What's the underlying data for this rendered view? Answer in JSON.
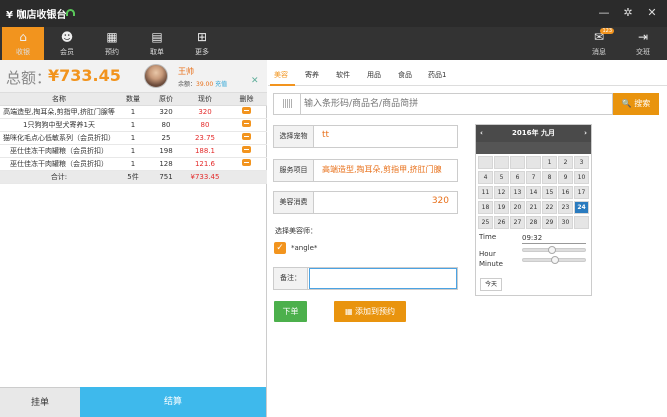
{
  "window": {
    "title": "¥ 咖店收银台"
  },
  "toolbar": {
    "items": [
      {
        "label": "收银",
        "icon": "home-icon"
      },
      {
        "label": "会员",
        "icon": "users-icon"
      },
      {
        "label": "预约",
        "icon": "calendar-icon"
      },
      {
        "label": "取单",
        "icon": "printer-icon"
      },
      {
        "label": "更多",
        "icon": "grid-icon"
      }
    ],
    "right": [
      {
        "label": "消息",
        "icon": "chat-icon",
        "badge": "123"
      },
      {
        "label": "交班",
        "icon": "exit-icon"
      }
    ]
  },
  "cart": {
    "total_label": "总额：",
    "total_value": "¥733.45",
    "member": {
      "name": "王帅",
      "balance_label": "余额：",
      "balance": "39.00",
      "recharge": "充值"
    },
    "columns": [
      "名称",
      "数量",
      "原价",
      "现价",
      "删除"
    ],
    "rows": [
      {
        "name": "高端造型,掏耳朵,剪指甲,挤肛门腺等",
        "qty": "1",
        "orig": "320",
        "price": "320"
      },
      {
        "name": "1只狗狗中型犬寄养1天",
        "qty": "1",
        "orig": "80",
        "price": "80"
      },
      {
        "name": "猫咪化毛点心低敏系列（会员折扣）",
        "qty": "1",
        "orig": "25",
        "price": "23.75"
      },
      {
        "name": "巫仕佳冻干肉罐粮（会员折扣）",
        "qty": "1",
        "orig": "198",
        "price": "188.1"
      },
      {
        "name": "巫仕佳冻干肉罐粮（会员折扣）",
        "qty": "1",
        "orig": "128",
        "price": "121.6"
      }
    ],
    "summary": {
      "label": "合计:",
      "qty": "5件",
      "orig": "751",
      "price": "¥733.45"
    }
  },
  "tabs": [
    "美容",
    "寄养",
    "软件",
    "用品",
    "食品",
    "药品1"
  ],
  "search": {
    "placeholder": "输入条形码/商品名/商品简拼",
    "button": "搜索"
  },
  "form": {
    "pet_label": "选择宠物",
    "pet_value": "tt",
    "service_label": "服务项目",
    "service_value": "高端造型,掏耳朵,剪指甲,挤肛门腺",
    "fee_label": "美容消费",
    "fee_value": "320",
    "beautician_label": "选择美容师：",
    "beautician_name": "*angle*",
    "note_label": "备注：",
    "submit": "下单",
    "reserve": "添加到预约"
  },
  "calendar": {
    "title": "2016年 九月",
    "prev": "‹",
    "next": "›",
    "weeks": [
      [
        "",
        "",
        "",
        "",
        "1",
        "2",
        "3"
      ],
      [
        "4",
        "5",
        "6",
        "7",
        "8",
        "9",
        "10"
      ],
      [
        "11",
        "12",
        "13",
        "14",
        "15",
        "16",
        "17"
      ],
      [
        "18",
        "19",
        "20",
        "21",
        "22",
        "23",
        "24"
      ],
      [
        "25",
        "26",
        "27",
        "28",
        "29",
        "30",
        ""
      ]
    ],
    "selected": "24",
    "time_label": "Time",
    "time_value": "09:32",
    "hour_label": "Hour",
    "minute_label": "Minute",
    "hour_fraction": 0.44,
    "minute_fraction": 0.5,
    "today": "今天"
  }
}
